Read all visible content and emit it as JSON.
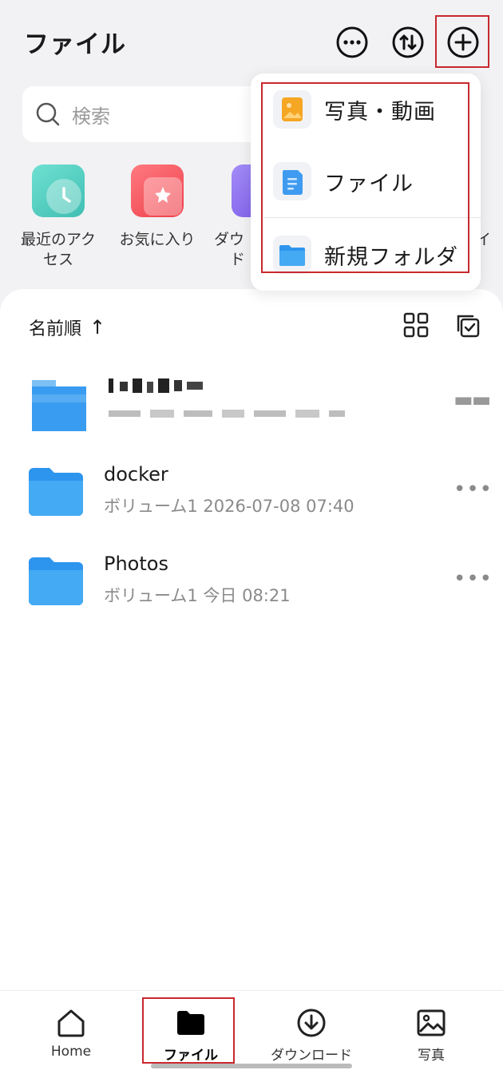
{
  "header": {
    "title": "ファイル",
    "icons": [
      "more-circle-icon",
      "sort-circle-icon",
      "add-circle-icon"
    ]
  },
  "search": {
    "placeholder": "検索"
  },
  "quick_access": [
    {
      "label": "最近のアクセス",
      "icon": "clock-icon",
      "color": "#5fd3c6"
    },
    {
      "label": "お気に入り",
      "icon": "star-icon",
      "color": "#f2555f"
    },
    {
      "label": "ダウ",
      "label2": "ド",
      "icon": "download-icon",
      "color": "#8b6cf0"
    },
    {
      "label": "イ"
    }
  ],
  "add_menu": {
    "items": [
      {
        "label": "写真・動画",
        "icon": "photo-video-icon"
      },
      {
        "label": "ファイル",
        "icon": "document-icon"
      },
      {
        "label": "新規フォルダ",
        "icon": "new-folder-icon"
      }
    ]
  },
  "file_list": {
    "sort_label": "名前順",
    "sort_arrow": "↑",
    "rows": [
      {
        "name": "",
        "meta": "",
        "blurred": true
      },
      {
        "name": "docker",
        "meta": "ボリューム1  2026-07-08 07:40"
      },
      {
        "name": "Photos",
        "meta": "ボリューム1 今日 08:21"
      }
    ],
    "more_glyph": "•••"
  },
  "tabbar": {
    "tabs": [
      {
        "label": "Home",
        "icon": "home-icon"
      },
      {
        "label": "ファイル",
        "icon": "folder-icon",
        "active": true
      },
      {
        "label": "ダウンロード",
        "icon": "download-cloud-icon"
      },
      {
        "label": "写真",
        "icon": "image-icon"
      }
    ]
  },
  "colors": {
    "highlight_border": "#c8282e",
    "folder_blue": "#3aa0f0",
    "background": "#f2f2f4"
  }
}
